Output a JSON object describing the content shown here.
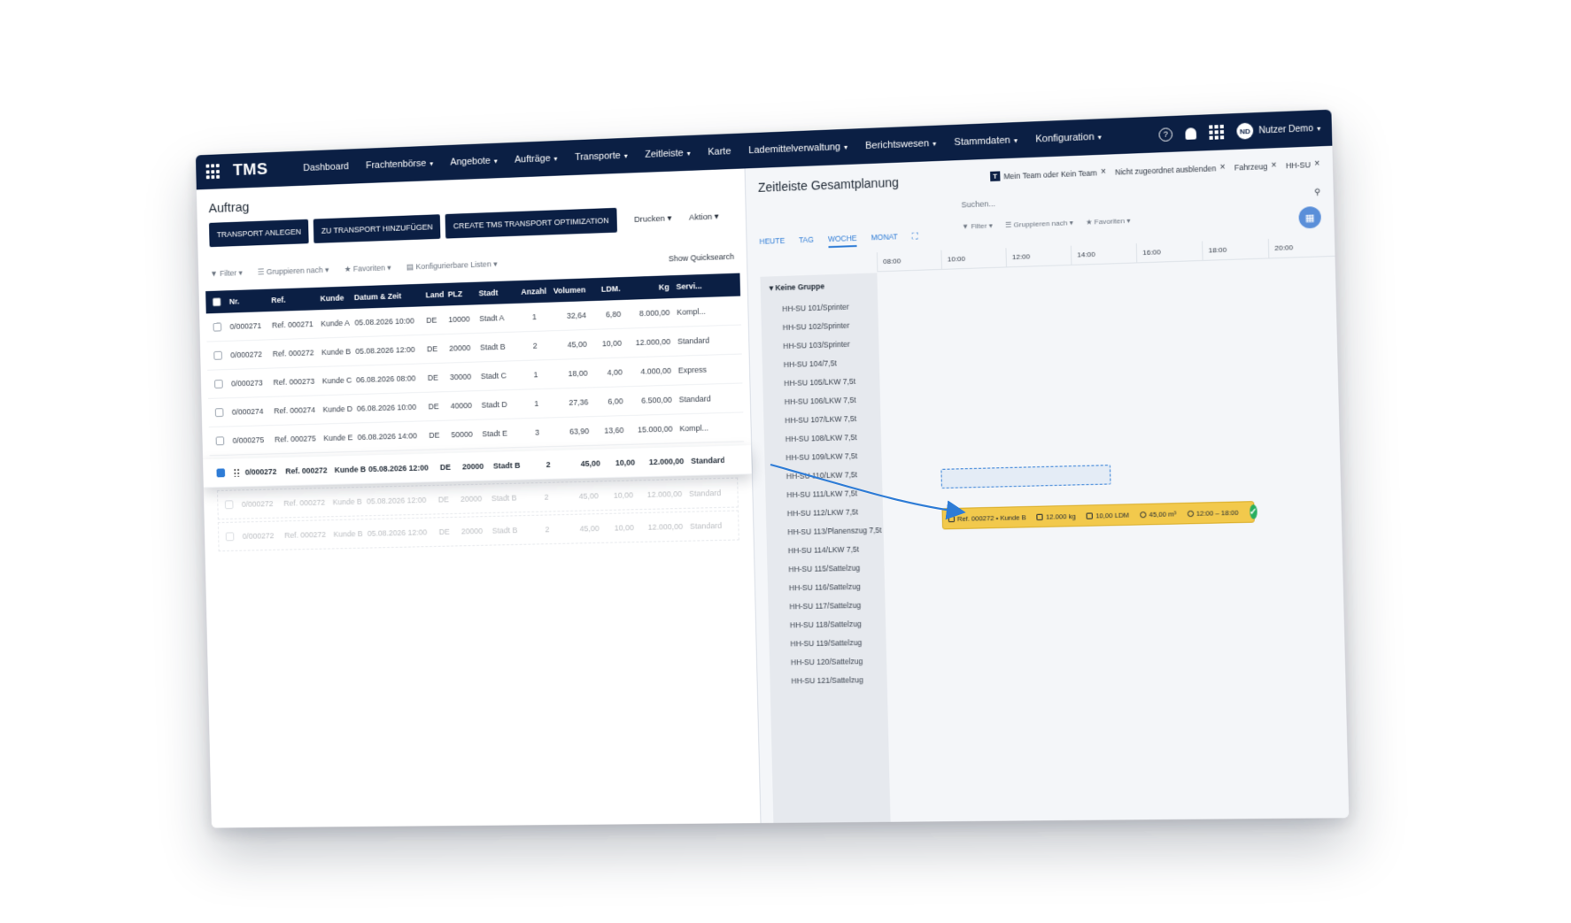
{
  "app": {
    "brand": "TMS"
  },
  "nav": {
    "items": [
      {
        "label": "Dashboard",
        "caret": false
      },
      {
        "label": "Frachtenbörse",
        "caret": true
      },
      {
        "label": "Angebote",
        "caret": true
      },
      {
        "label": "Aufträge",
        "caret": true
      },
      {
        "label": "Transporte",
        "caret": true
      },
      {
        "label": "Zeitleiste",
        "caret": true
      },
      {
        "label": "Karte",
        "caret": false
      },
      {
        "label": "Lademittelverwaltung",
        "caret": true
      },
      {
        "label": "Berichtswesen",
        "caret": true
      },
      {
        "label": "Stammdaten",
        "caret": true
      },
      {
        "label": "Konfiguration",
        "caret": true
      }
    ],
    "help": "?",
    "user_initials": "ND",
    "user_name": "Nutzer Demo"
  },
  "left": {
    "title": "Auftrag",
    "buttons": {
      "transport_anlegen": "TRANSPORT ANLEGEN",
      "zu_transport": "ZU TRANSPORT HINZUFÜGEN",
      "optimization": "CREATE TMS TRANSPORT OPTIMIZATION",
      "drucken": "Drucken",
      "aktion": "Aktion"
    },
    "filterbar": {
      "filter": "Filter",
      "gruppieren": "Gruppieren nach",
      "favoriten": "Favoriten",
      "listen": "Konfigurierbare Listen",
      "quicksearch": "Show Quicksearch"
    },
    "columns": [
      "Nr.",
      "Ref.",
      "Kunde",
      "Datum & Zeit",
      "Land",
      "PLZ",
      "Stadt",
      "Anzahl",
      "Volumen",
      "LDM.",
      "Kg",
      "Servi..."
    ],
    "rows": [
      {
        "nr": "0/000271",
        "ref": "Ref. 000271",
        "kunde": "Kunde A",
        "datum": "05.08.2026 10:00",
        "land": "DE",
        "plz": "10000",
        "stadt": "Stadt A",
        "anzahl": "1",
        "volumen": "32,64",
        "ldm": "6,80",
        "kg": "8.000,00",
        "service": "Kompl..."
      },
      {
        "nr": "0/000272",
        "ref": "Ref. 000272",
        "kunde": "Kunde B",
        "datum": "05.08.2026 12:00",
        "land": "DE",
        "plz": "20000",
        "stadt": "Stadt B",
        "anzahl": "2",
        "volumen": "45,00",
        "ldm": "10,00",
        "kg": "12.000,00",
        "service": "Standard"
      },
      {
        "nr": "0/000273",
        "ref": "Ref. 000273",
        "kunde": "Kunde C",
        "datum": "06.08.2026 08:00",
        "land": "DE",
        "plz": "30000",
        "stadt": "Stadt C",
        "anzahl": "1",
        "volumen": "18,00",
        "ldm": "4,00",
        "kg": "4.000,00",
        "service": "Express"
      },
      {
        "nr": "0/000274",
        "ref": "Ref. 000274",
        "kunde": "Kunde D",
        "datum": "06.08.2026 10:00",
        "land": "DE",
        "plz": "40000",
        "stadt": "Stadt D",
        "anzahl": "1",
        "volumen": "27,36",
        "ldm": "6,00",
        "kg": "6.500,00",
        "service": "Standard"
      },
      {
        "nr": "0/000275",
        "ref": "Ref. 000275",
        "kunde": "Kunde E",
        "datum": "06.08.2026 14:00",
        "land": "DE",
        "plz": "50000",
        "stadt": "Stadt E",
        "anzahl": "3",
        "volumen": "63,90",
        "ldm": "13,60",
        "kg": "15.000,00",
        "service": "Kompl..."
      }
    ],
    "dragged_row": {
      "nr": "0/000272",
      "ref": "Ref. 000272",
      "kunde": "Kunde B",
      "datum": "05.08.2026 12:00",
      "land": "DE",
      "plz": "20000",
      "stadt": "Stadt B",
      "anzahl": "2",
      "volumen": "45,00",
      "ldm": "10,00",
      "kg": "12.000,00",
      "service": "Standard"
    }
  },
  "right": {
    "title": "Zeitleiste Gesamtplanung",
    "chips": [
      {
        "label": "Mein Team oder Kein Team",
        "badge": "T"
      },
      {
        "label": "Nicht zugeordnet ausblenden"
      },
      {
        "label": "Fahrzeug"
      },
      {
        "label": "HH-SU"
      }
    ],
    "search_placeholder": "Suchen...",
    "views": [
      "HEUTE",
      "TAG",
      "WOCHE",
      "MONAT"
    ],
    "active_view": "WOCHE",
    "filters": {
      "filter": "Filter",
      "gruppieren": "Gruppieren nach",
      "favoriten": "Favoriten"
    },
    "times": [
      "08:00",
      "10:00",
      "12:00",
      "14:00",
      "16:00",
      "18:00",
      "20:00"
    ],
    "group_header": "Keine Gruppe",
    "vehicles": [
      "HH-SU 101/Sprinter",
      "HH-SU 102/Sprinter",
      "HH-SU 103/Sprinter",
      "HH-SU 104/7,5t",
      "HH-SU 105/LKW 7,5t",
      "HH-SU 106/LKW 7,5t",
      "HH-SU 107/LKW 7,5t",
      "HH-SU 108/LKW 7,5t",
      "HH-SU 109/LKW 7,5t",
      "HH-SU 110/LKW 7,5t",
      "HH-SU 111/LKW 7,5t",
      "HH-SU 112/LKW 7,5t",
      "HH-SU 113/Planenszug 7,5t",
      "HH-SU 114/LKW 7,5t",
      "HH-SU 115/Sattelzug",
      "HH-SU 116/Sattelzug",
      "HH-SU 117/Sattelzug",
      "HH-SU 118/Sattelzug",
      "HH-SU 119/Sattelzug",
      "HH-SU 120/Sattelzug",
      "HH-SU 121/Sattelzug"
    ],
    "transport_bar": {
      "ref": "Ref. 000272 • Kunde B",
      "weight": "12.000 kg",
      "ldm": "10,00 LDM",
      "volume": "45,00 m³",
      "time": "12:00 – 18:00"
    }
  },
  "colors": {
    "navy": "#0b1f44",
    "accent": "#2e7cd6",
    "bar": "#f2c94c",
    "ok": "#27ae60"
  }
}
